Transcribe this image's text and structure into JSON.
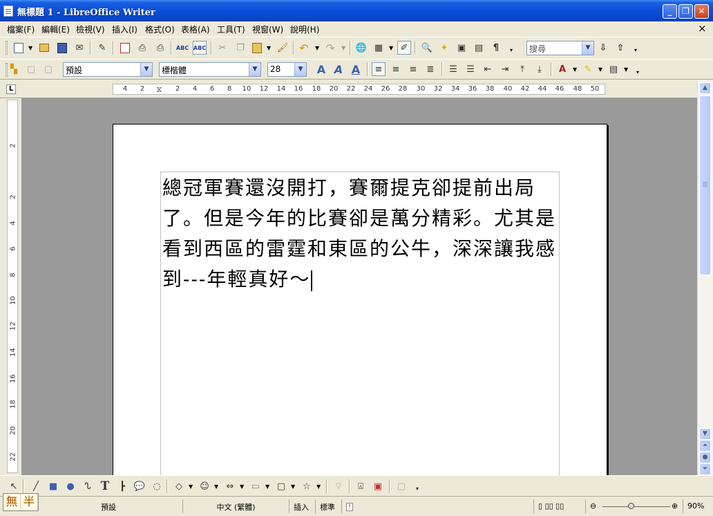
{
  "window": {
    "title": "無標題 1 - LibreOffice Writer"
  },
  "menubar": {
    "items": [
      "檔案(F)",
      "編輯(E)",
      "檢視(V)",
      "插入(I)",
      "格式(O)",
      "表格(A)",
      "工具(T)",
      "視窗(W)",
      "說明(H)"
    ],
    "close_doc": "×"
  },
  "toolbar": {
    "search_placeholder": "搜尋",
    "paragraph_style": "預設",
    "font_name": "標楷體",
    "font_size": "28"
  },
  "ruler": {
    "horizontal_labels": [
      "4",
      "2",
      "2",
      "4",
      "6",
      "8",
      "10",
      "12",
      "14",
      "16",
      "18",
      "20",
      "22",
      "24",
      "26",
      "28",
      "30",
      "32",
      "34",
      "36",
      "38",
      "40",
      "42",
      "44",
      "46",
      "48",
      "50"
    ],
    "vertical_labels": [
      "2",
      "2",
      "4",
      "6",
      "8",
      "10",
      "12",
      "14",
      "16",
      "18",
      "20",
      "22"
    ]
  },
  "document": {
    "text": "總冠軍賽還沒開打，賽爾提克卻提前出局了。但是今年的比賽卻是萬分精彩。尤其是看到西區的雷霆和東區的公牛，深深讓我感到---年輕真好～"
  },
  "statusbar": {
    "ime_left": "無",
    "ime_right": "半",
    "page_style": "預設",
    "language": "中文 (繁體)",
    "insert_mode": "插入",
    "selection_mode": "標準",
    "zoom": "90%"
  },
  "colors": {
    "titlebar": "#0a4fd8",
    "chrome": "#ece9d8",
    "workspace": "#9a9a9a"
  }
}
